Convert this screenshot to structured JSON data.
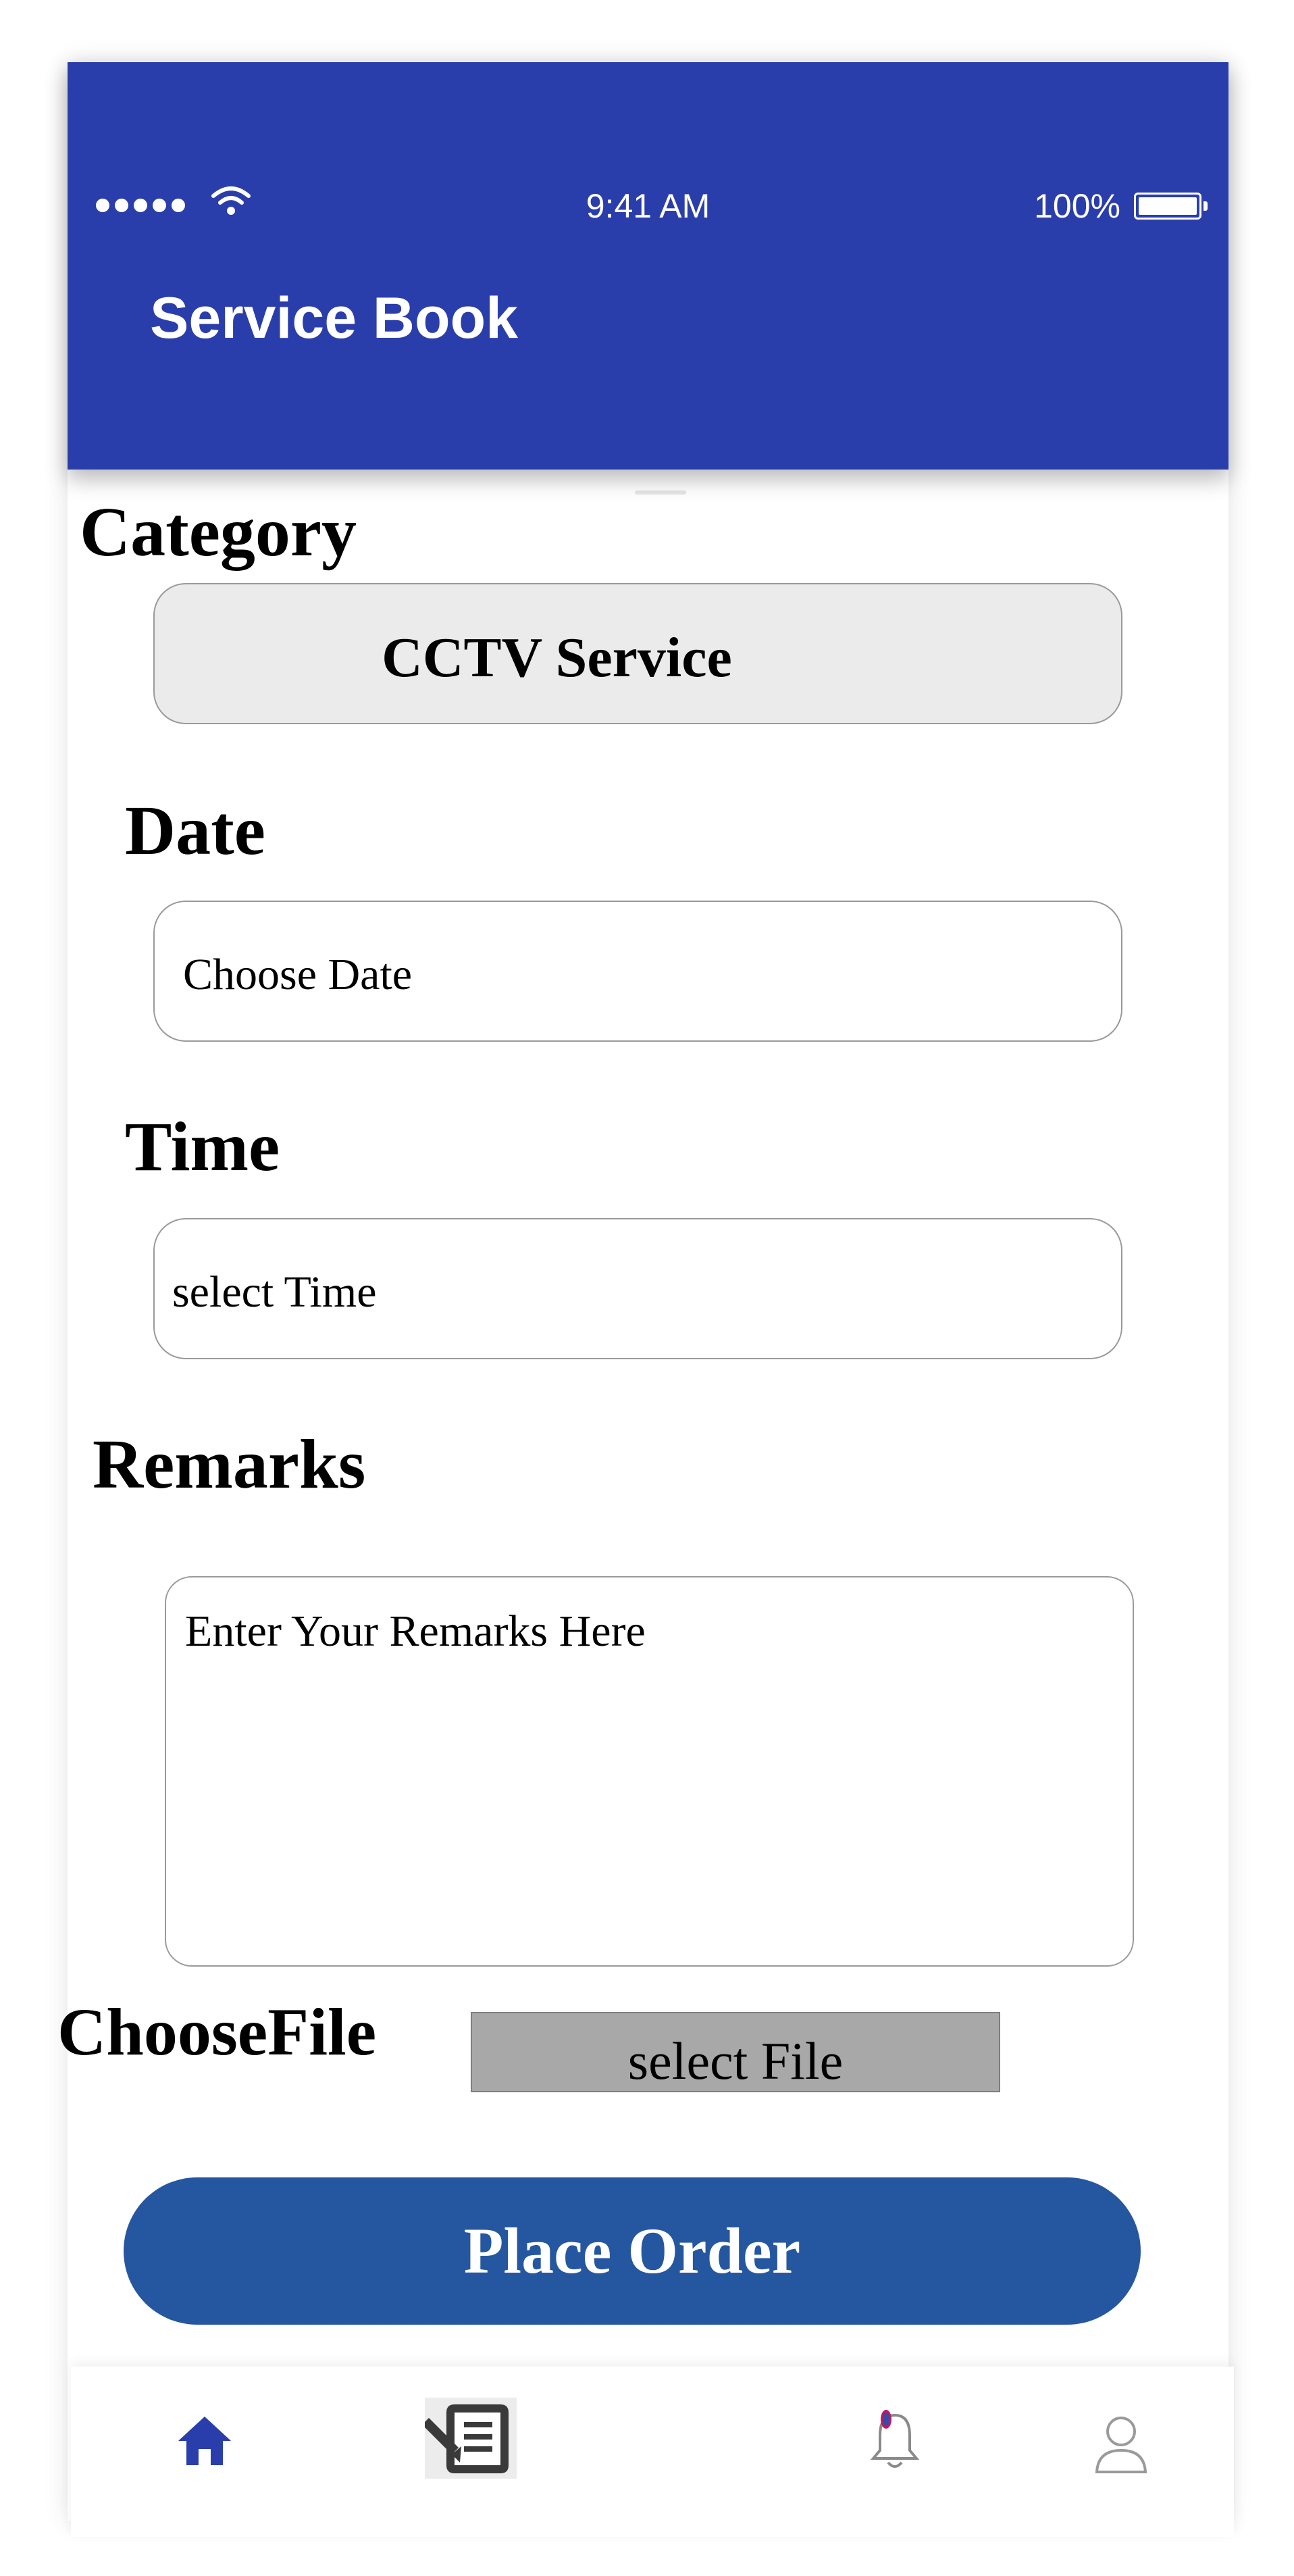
{
  "status_bar": {
    "time": "9:41 AM",
    "battery": "100%"
  },
  "header": {
    "title": "Service Book"
  },
  "form": {
    "category_label": "Category",
    "category_value": "CCTV Service",
    "date_label": "Date",
    "date_placeholder": "Choose Date",
    "time_label": "Time",
    "time_placeholder": "select Time",
    "remarks_label": "Remarks",
    "remarks_placeholder": "Enter Your Remarks Here",
    "file_label": "ChooseFile",
    "file_button": "select File",
    "submit_label": "Place Order"
  },
  "nav": {
    "items": [
      {
        "icon": "home-icon",
        "active": true
      },
      {
        "icon": "orders-icon"
      },
      {
        "icon": "bell-icon"
      },
      {
        "icon": "profile-icon"
      }
    ]
  },
  "colors": {
    "header": "#2a3eab",
    "button": "#2557a0",
    "category_field": "#ebebeb",
    "file_button": "#a8a8a8"
  }
}
